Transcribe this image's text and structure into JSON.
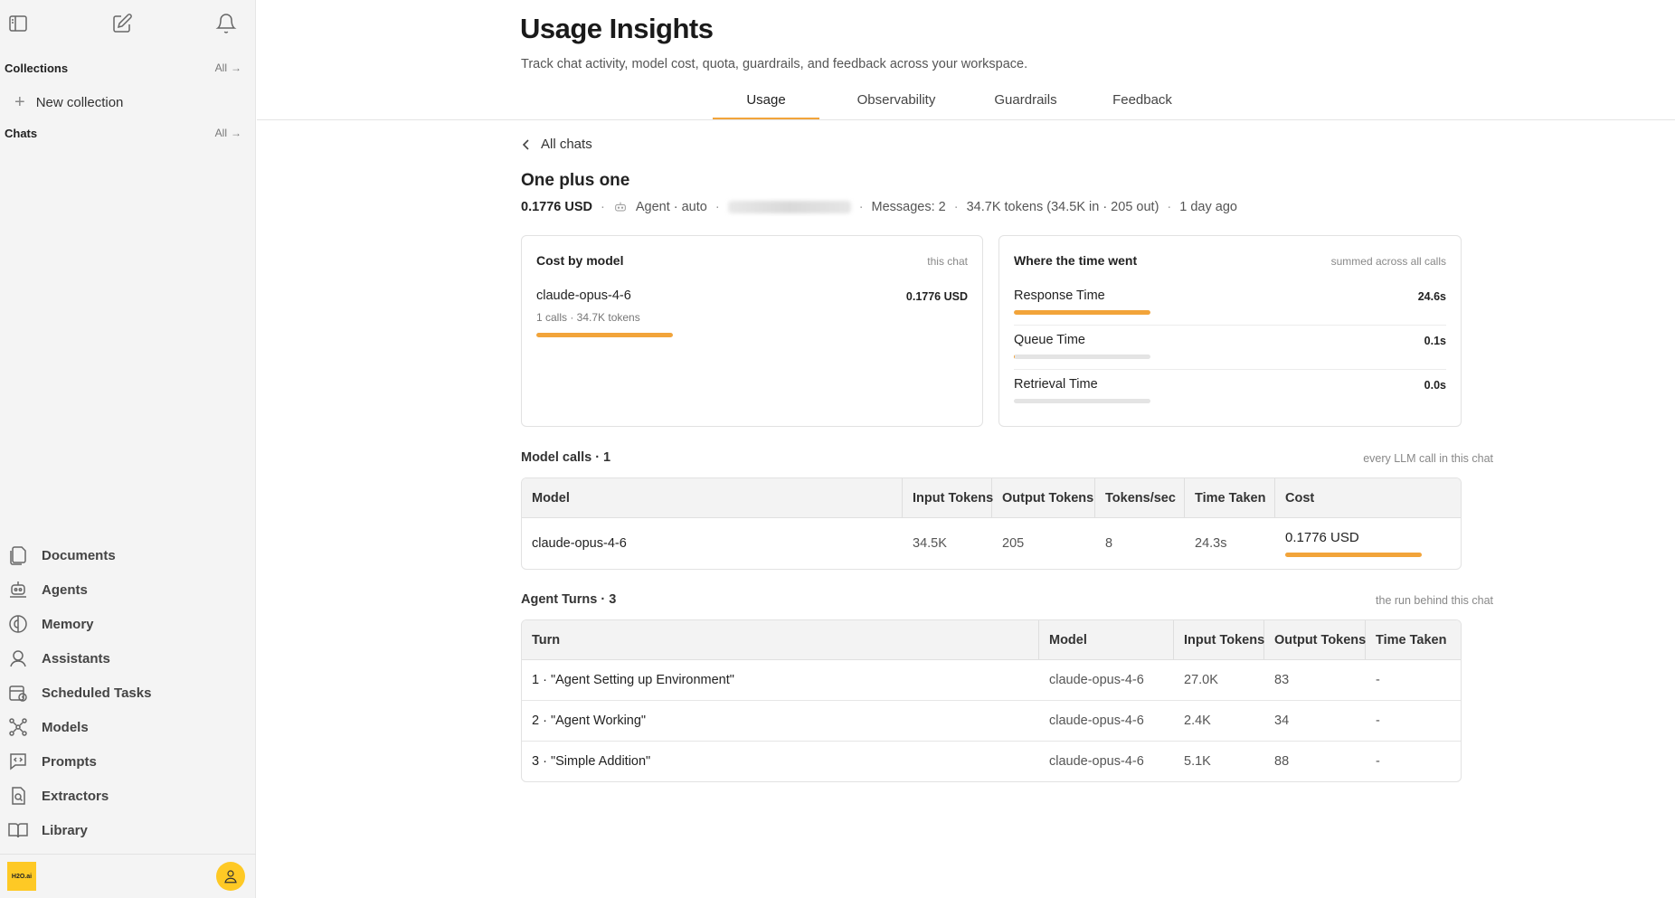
{
  "sidebar": {
    "collections_label": "Collections",
    "collections_all": "All",
    "new_collection": "New collection",
    "chats_label": "Chats",
    "chats_all": "All",
    "nav": [
      {
        "label": "Documents",
        "icon": "documents-icon"
      },
      {
        "label": "Agents",
        "icon": "agents-icon"
      },
      {
        "label": "Memory",
        "icon": "memory-icon"
      },
      {
        "label": "Assistants",
        "icon": "assistants-icon"
      },
      {
        "label": "Scheduled Tasks",
        "icon": "scheduled-tasks-icon"
      },
      {
        "label": "Models",
        "icon": "models-icon"
      },
      {
        "label": "Prompts",
        "icon": "prompts-icon"
      },
      {
        "label": "Extractors",
        "icon": "extractors-icon"
      },
      {
        "label": "Library",
        "icon": "library-icon"
      }
    ],
    "logo_text": "H2O.ai"
  },
  "header": {
    "title": "Usage Insights",
    "subtitle": "Track chat activity, model cost, quota, guardrails, and feedback across your workspace.",
    "tabs": [
      {
        "label": "Usage",
        "active": true
      },
      {
        "label": "Observability",
        "active": false
      },
      {
        "label": "Guardrails",
        "active": false
      },
      {
        "label": "Feedback",
        "active": false
      }
    ]
  },
  "chat": {
    "back_label": "All chats",
    "title": "One plus one",
    "cost": "0.1776 USD",
    "agent": "Agent · auto",
    "messages": "Messages: 2",
    "tokens": "34.7K tokens (34.5K in · 205 out)",
    "age": "1 day ago"
  },
  "cost_card": {
    "title": "Cost by model",
    "note": "this chat",
    "model": "claude-opus-4-6",
    "value": "0.1776 USD",
    "sub": "1 calls · 34.7K tokens",
    "fraction": 1.0
  },
  "time_card": {
    "title": "Where the time went",
    "note": "summed across all calls",
    "rows": [
      {
        "label": "Response Time",
        "value": "24.6s",
        "fraction": 1.0
      },
      {
        "label": "Queue Time",
        "value": "0.1s",
        "fraction": 0.004
      },
      {
        "label": "Retrieval Time",
        "value": "0.0s",
        "fraction": 0.0
      }
    ]
  },
  "model_calls": {
    "heading": "Model calls · 1",
    "note": "every LLM call in this chat",
    "columns": [
      "Model",
      "Input Tokens",
      "Output Tokens",
      "Tokens/sec",
      "Time Taken",
      "Cost"
    ],
    "rows": [
      {
        "model": "claude-opus-4-6",
        "input": "34.5K",
        "output": "205",
        "tps": "8",
        "time": "24.3s",
        "cost": "0.1776 USD"
      }
    ]
  },
  "agent_turns": {
    "heading": "Agent Turns · 3",
    "note": "the run behind this chat",
    "columns": [
      "Turn",
      "Model",
      "Input Tokens",
      "Output Tokens",
      "Time Taken"
    ],
    "rows": [
      {
        "turn": "1 · \"Agent Setting up Environment\"",
        "model": "claude-opus-4-6",
        "input": "27.0K",
        "output": "83",
        "time": "-"
      },
      {
        "turn": "2 · \"Agent Working\"",
        "model": "claude-opus-4-6",
        "input": "2.4K",
        "output": "34",
        "time": "-"
      },
      {
        "turn": "3 · \"Simple Addition\"",
        "model": "claude-opus-4-6",
        "input": "5.1K",
        "output": "88",
        "time": "-"
      }
    ]
  },
  "colors": {
    "accent": "#f2a43a",
    "brand": "#fec925"
  }
}
